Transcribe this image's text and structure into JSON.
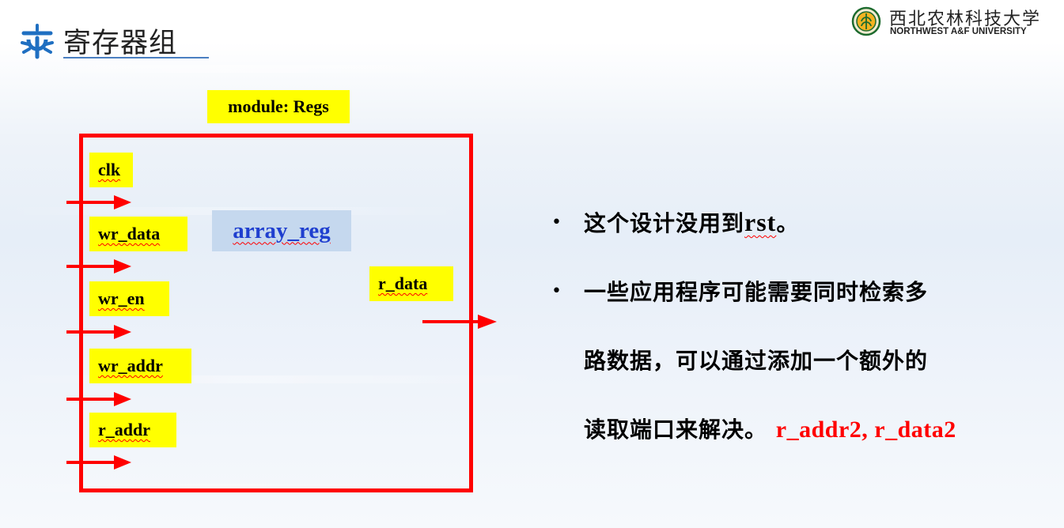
{
  "slide": {
    "title": "寄存器组",
    "logo_cn": "西北农林科技大学",
    "logo_en": "NORTHWEST A&F UNIVERSITY"
  },
  "diagram": {
    "module_label": "module: Regs",
    "inner_label": "array_reg",
    "input_ports": [
      "clk",
      "wr_data",
      "wr_en",
      "wr_addr",
      "r_addr"
    ],
    "output_port": "r_data",
    "colors": {
      "box": "#ff0000",
      "port_bg": "#ffff00",
      "inner_bg": "#c5d8ee",
      "inner_text": "#1f3fcf"
    }
  },
  "bullets": {
    "item1_text": "这个设计没用到",
    "item1_code": "rst",
    "item1_end": "。",
    "item2_line1": "一些应用程序可能需要同时检索多",
    "item2_line2": "路数据，可以通过添加一个额外的",
    "item2_line3": "读取端口来解决。",
    "item2_code": "r_addr2,  r_data2",
    "bullet_char": "•",
    "highlight_color": "#ff0000"
  }
}
